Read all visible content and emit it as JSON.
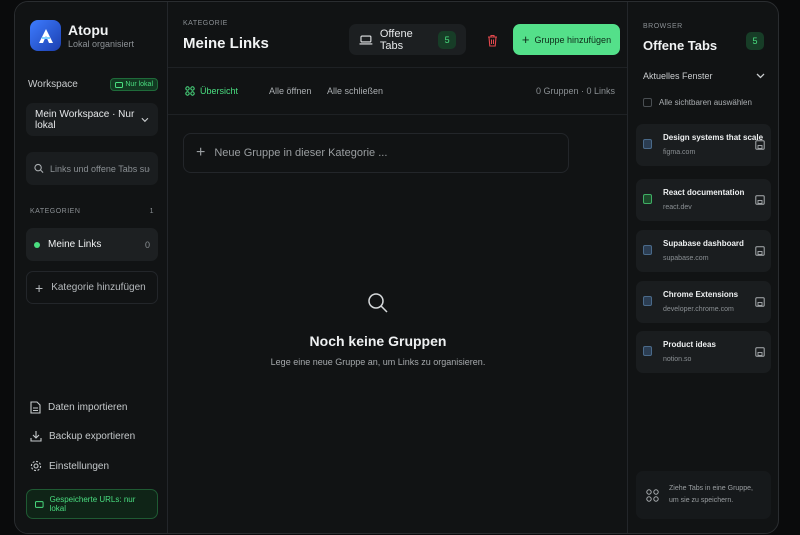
{
  "app": {
    "name": "Atopu",
    "subtitle": "Lokal organisiert"
  },
  "sidebar": {
    "workspace_label": "Workspace",
    "local_badge": "Nur lokal",
    "workspace_selected": "Mein Workspace · Nur lokal",
    "search_placeholder": "Links und offene Tabs suchen",
    "categories_header": "KATEGORIEN",
    "categories_count": "1",
    "categories": [
      {
        "label": "Meine Links",
        "count": "0"
      }
    ],
    "add_category": "Kategorie hinzufügen",
    "links": [
      {
        "label": "Daten importieren",
        "icon": "file-icon"
      },
      {
        "label": "Backup exportieren",
        "icon": "download-icon"
      },
      {
        "label": "Einstellungen",
        "icon": "gear-icon"
      }
    ],
    "saved_badge": "Gespeicherte URLs: nur lokal"
  },
  "main": {
    "kicker": "KATEGORIE",
    "title": "Meine Links",
    "open_tabs_label": "Offene Tabs",
    "open_tabs_count": "5",
    "add_group_label": "Gruppe hinzufügen",
    "tabs": [
      {
        "label": "Übersicht",
        "active": true
      },
      {
        "label": "Alle öffnen",
        "active": false
      },
      {
        "label": "Alle schließen",
        "active": false
      }
    ],
    "summary": "0 Gruppen · 0 Links",
    "new_group_placeholder": "Neue Gruppe in dieser Kategorie ...",
    "empty_title": "Noch keine Gruppen",
    "empty_subtitle": "Lege eine neue Gruppe an, um Links zu organisieren."
  },
  "browser": {
    "kicker": "BROWSER",
    "title": "Offene Tabs",
    "count": "5",
    "window_select": "Aktuelles Fenster",
    "select_all": "Alle sichtbaren auswählen",
    "tabs": [
      {
        "title": "Design systems that scale",
        "url": "figma.com"
      },
      {
        "title": "React documentation",
        "url": "react.dev"
      },
      {
        "title": "Supabase dashboard",
        "url": "supabase.com"
      },
      {
        "title": "Chrome Extensions",
        "url": "developer.chrome.com"
      },
      {
        "title": "Product ideas",
        "url": "notion.so"
      }
    ],
    "hint_line1": "Ziehe Tabs in eine Gruppe,",
    "hint_line2": "um sie zu speichern."
  },
  "colors": {
    "accent": "#54e08a",
    "accent_text": "#4ade80",
    "danger": "#e5484d",
    "logo": "#3d7cff"
  }
}
